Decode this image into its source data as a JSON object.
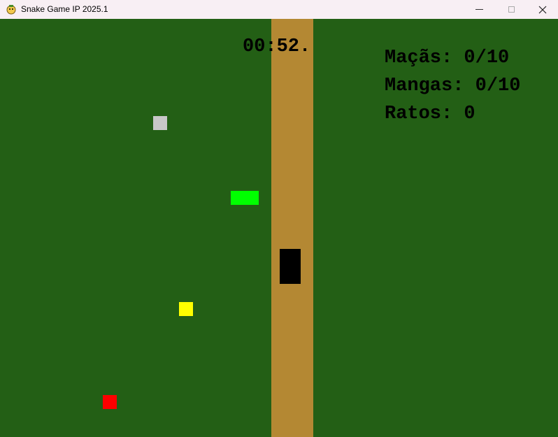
{
  "window": {
    "title": "Snake Game IP 2025.1",
    "icon": "pygame-snake-icon",
    "controls": {
      "minimize": "minimize-icon",
      "maximize": "maximize-icon",
      "close": "close-icon"
    }
  },
  "hud": {
    "timer": "00:52.",
    "apples": "Maçãs: 0/10",
    "mangoes": "Mangas: 0/10",
    "rats": "Ratos: 0"
  },
  "colors": {
    "grass": "#235f15",
    "road": "#b48833",
    "snake": "#00ff00",
    "apple": "#ff0000",
    "mango": "#ffff00",
    "rat": "#c8c8c8",
    "obstacle": "#000000",
    "text": "#000000"
  }
}
